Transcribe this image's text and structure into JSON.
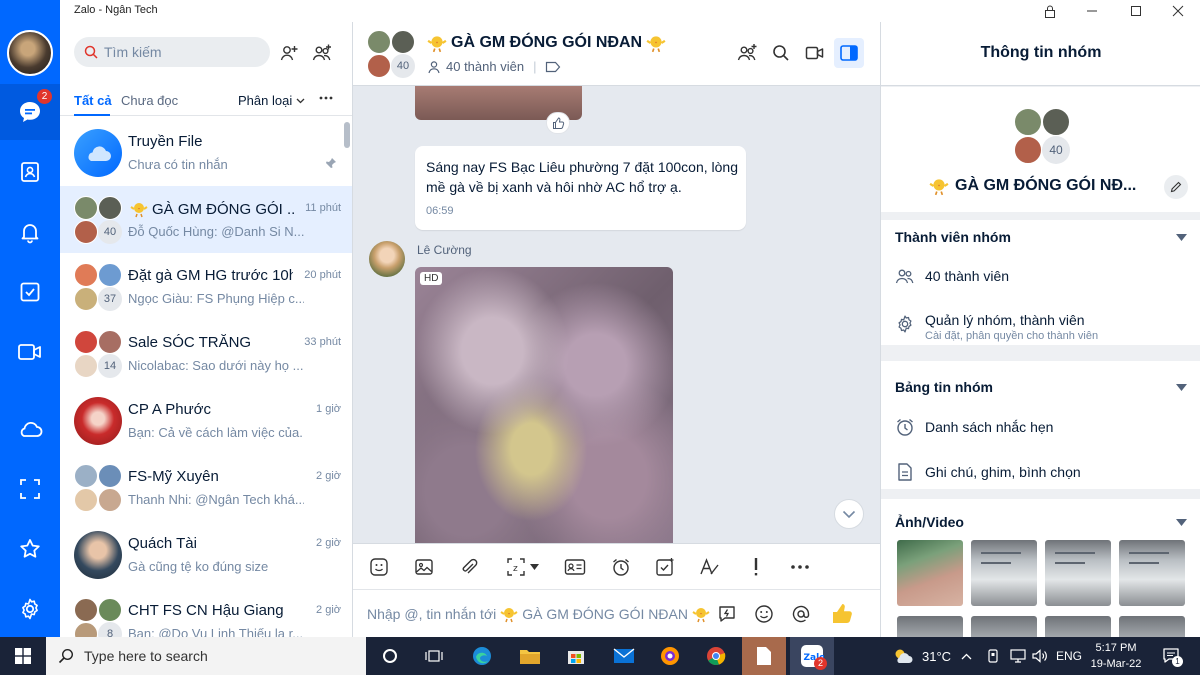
{
  "window": {
    "title": "Zalo - Ngân Tech"
  },
  "nav": {
    "badge_count": "2",
    "items": [
      "chat-icon",
      "contacts-icon",
      "bell-icon",
      "todo-icon",
      "video-icon",
      "cloud-icon",
      "screenshot-icon",
      "star-icon",
      "gear-icon"
    ],
    "accent_color": "#0068ff"
  },
  "sidebar": {
    "search_placeholder": "Tìm kiếm",
    "tabs": [
      "Tất cả",
      "Chưa đọc"
    ],
    "classify_label": "Phân loại",
    "conversations": [
      {
        "name": "Truyền File",
        "time": "",
        "message": "Chưa có tin nhắn",
        "count": ""
      },
      {
        "name": "GÀ GM ĐÓNG GÓI ...",
        "time": "11 phút",
        "message": "Đỗ Quốc Hùng: @Danh Si N...",
        "count": "40"
      },
      {
        "name": "Đặt gà GM HG trước 10h",
        "time": "20 phút",
        "message": "Ngọc Giàu: FS Phụng Hiệp c...",
        "count": "37"
      },
      {
        "name": "Sale SÓC TRĂNG",
        "time": "33 phút",
        "message": "Nicolabac: Sao dưới này họ ...",
        "count": "14"
      },
      {
        "name": "CP A Phước",
        "time": "1 giờ",
        "message": "Bạn: Cả về cách làm việc của...",
        "count": ""
      },
      {
        "name": "FS-Mỹ Xuyên",
        "time": "2 giờ",
        "message": "Thanh Nhi: @Ngân Tech khá...",
        "count": ""
      },
      {
        "name": "Quách Tài",
        "time": "2 giờ",
        "message": "Gà cũng tệ ko đúng size",
        "count": ""
      },
      {
        "name": "CHT FS CN Hậu Giang",
        "time": "2 giờ",
        "message": "Bạn: @Do Vu Linh Thiếu lạ r...",
        "count": "8"
      }
    ]
  },
  "chat": {
    "group_name": "GÀ GM ĐÓNG GÓI NĐAN",
    "member_count": "40",
    "member_label": "40 thành viên",
    "messages": [
      {
        "text": "Sáng nay FS Bạc Liêu phường 7 đặt 100con, lòng mề gà về bị xanh và hôi nhờ AC hổ trợ ạ.",
        "time": "06:59"
      }
    ],
    "photo_sender": "Lê Cường",
    "photo_badge": "HD",
    "composer_placeholder": "Nhập @, tin nhắn tới",
    "composer_group": "GÀ GM ĐÓNG GÓI NĐAN"
  },
  "info_panel": {
    "title": "Thông tin nhóm",
    "avatar_count": "40",
    "group_name": "GÀ GM ĐÓNG GÓI NĐ...",
    "members_section": "Thành viên nhóm",
    "members_row": "40 thành viên",
    "manage_row": "Quản lý nhóm, thành viên",
    "manage_sub": "Cài đặt, phân quyền cho thành viên",
    "board_section": "Bảng tin nhóm",
    "reminder_row": "Danh sách nhắc hẹn",
    "notes_row": "Ghi chú, ghim, bình chọn",
    "media_section": "Ảnh/Video"
  },
  "taskbar": {
    "search_placeholder": "Type here to search",
    "weather": "31°C",
    "language": "ENG",
    "time": "5:17 PM",
    "date": "19-Mar-22",
    "zalo_badge": "2",
    "notification_count": "1"
  }
}
